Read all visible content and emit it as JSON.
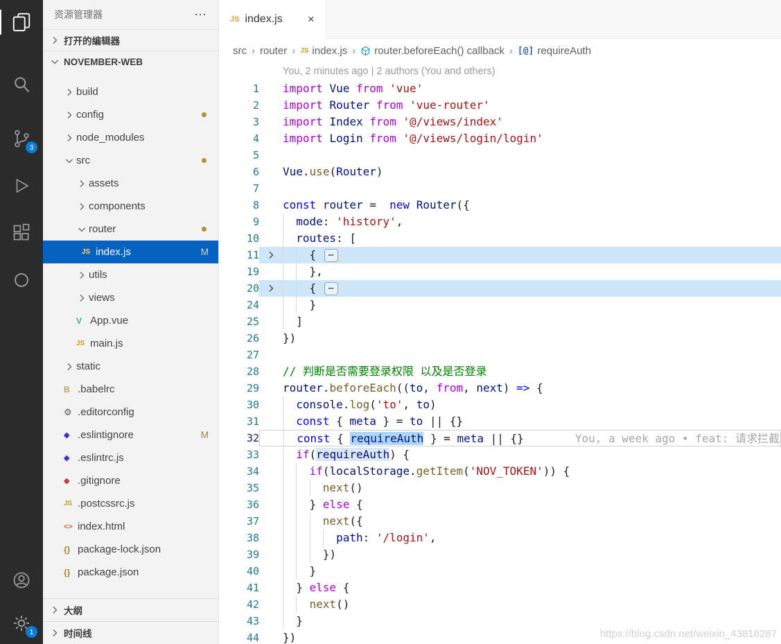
{
  "app": {
    "watermark": "https://blog.csdn.net/weixin_43816287"
  },
  "colors": {
    "activity_bar_bg": "#2b2b2b",
    "badge_blue": "#0c7bd5",
    "sidebar_bg": "#f3f3f3",
    "list_selection_bg": "#0661c1",
    "git_modified": "#a0852f",
    "fold_highlight_bg": "#cfe5f8",
    "selection_bg": "#add6ff",
    "syntax": {
      "keyword": "#af00db",
      "storage": "#0000ff",
      "string": "#a31515",
      "variable": "#001080",
      "function": "#795e26",
      "comment": "#008000",
      "plain": "#1e1e1e"
    }
  },
  "activity_bar": {
    "top": [
      {
        "icon": "explorer",
        "name": "explorer",
        "active": true
      },
      {
        "icon": "search",
        "name": "search"
      },
      {
        "icon": "source-control",
        "name": "source-control",
        "badge": "3"
      },
      {
        "icon": "run-debug",
        "name": "run-debug"
      },
      {
        "icon": "extensions",
        "name": "extensions"
      },
      {
        "icon": "circle",
        "name": "circle"
      }
    ],
    "bottom": [
      {
        "icon": "account",
        "name": "account"
      },
      {
        "icon": "settings",
        "name": "settings",
        "badge": "1"
      }
    ]
  },
  "sidebar": {
    "title": "资源管理器",
    "more_label": "⋯",
    "open_editors_label": "打开的编辑器",
    "root_label": "NOVEMBER-WEB",
    "outline_label": "大纲",
    "timeline_label": "时间线",
    "tree": [
      {
        "label": "build",
        "kind": "folder",
        "level": 1,
        "state": "collapsed"
      },
      {
        "label": "config",
        "kind": "folder",
        "level": 1,
        "state": "collapsed",
        "dot": true
      },
      {
        "label": "node_modules",
        "kind": "folder",
        "level": 1,
        "state": "collapsed"
      },
      {
        "label": "src",
        "kind": "folder",
        "level": 1,
        "state": "expanded",
        "dot": true
      },
      {
        "label": "assets",
        "kind": "folder",
        "level": 2,
        "state": "collapsed"
      },
      {
        "label": "components",
        "kind": "folder",
        "level": 2,
        "state": "collapsed"
      },
      {
        "label": "router",
        "kind": "folder",
        "level": 2,
        "state": "expanded",
        "dot": true
      },
      {
        "label": "index.js",
        "kind": "file",
        "icon": "js",
        "level": 3,
        "selected": true,
        "badge": "M"
      },
      {
        "label": "utils",
        "kind": "folder",
        "level": 2,
        "state": "collapsed"
      },
      {
        "label": "views",
        "kind": "folder",
        "level": 2,
        "state": "collapsed"
      },
      {
        "label": "App.vue",
        "kind": "file",
        "icon": "vue",
        "level": 2
      },
      {
        "label": "main.js",
        "kind": "file",
        "icon": "js",
        "level": 2
      },
      {
        "label": "static",
        "kind": "folder",
        "level": 1,
        "state": "collapsed"
      },
      {
        "label": ".babelrc",
        "kind": "file",
        "icon": "babel",
        "level": 1
      },
      {
        "label": ".editorconfig",
        "kind": "file",
        "icon": "editorconfig",
        "level": 1
      },
      {
        "label": ".eslintignore",
        "kind": "file",
        "icon": "eslint",
        "level": 1,
        "badge": "M"
      },
      {
        "label": ".eslintrc.js",
        "kind": "file",
        "icon": "eslint",
        "level": 1
      },
      {
        "label": ".gitignore",
        "kind": "file",
        "icon": "git",
        "level": 1
      },
      {
        "label": ".postcssrc.js",
        "kind": "file",
        "icon": "js",
        "level": 1
      },
      {
        "label": "index.html",
        "kind": "file",
        "icon": "html",
        "level": 1
      },
      {
        "label": "package-lock.json",
        "kind": "file",
        "icon": "json",
        "level": 1
      },
      {
        "label": "package.json",
        "kind": "file",
        "icon": "json",
        "level": 1
      }
    ]
  },
  "editor": {
    "tab": {
      "label": "index.js",
      "icon": "js",
      "close": "×"
    },
    "breadcrumbs": [
      {
        "label": "src"
      },
      {
        "label": "router"
      },
      {
        "label": "index.js",
        "icon": "js"
      },
      {
        "label": "router.beforeEach() callback",
        "icon": "symbol-method"
      },
      {
        "label": "requireAuth",
        "icon": "symbol-field"
      }
    ],
    "codelens": "You, 2 minutes ago | 2 authors (You and others)",
    "inline_blame": "You, a week ago • feat: 请求拦截",
    "fold_placeholder": "⋯",
    "code_lines": [
      {
        "n": 1,
        "t": [
          [
            "import",
            "k"
          ],
          [
            " ",
            "p"
          ],
          [
            "Vue",
            "v"
          ],
          [
            " ",
            "p"
          ],
          [
            "from",
            "k"
          ],
          [
            " ",
            "p"
          ],
          [
            "'vue'",
            "t"
          ]
        ]
      },
      {
        "n": 2,
        "t": [
          [
            "import",
            "k"
          ],
          [
            " ",
            "p"
          ],
          [
            "Router",
            "v"
          ],
          [
            " ",
            "p"
          ],
          [
            "from",
            "k"
          ],
          [
            " ",
            "p"
          ],
          [
            "'vue-router'",
            "t"
          ]
        ]
      },
      {
        "n": 3,
        "t": [
          [
            "import",
            "k"
          ],
          [
            " ",
            "p"
          ],
          [
            "Index",
            "v"
          ],
          [
            " ",
            "p"
          ],
          [
            "from",
            "k"
          ],
          [
            " ",
            "p"
          ],
          [
            "'@/views/index'",
            "t"
          ]
        ]
      },
      {
        "n": 4,
        "t": [
          [
            "import",
            "k"
          ],
          [
            " ",
            "p"
          ],
          [
            "Login",
            "v"
          ],
          [
            " ",
            "p"
          ],
          [
            "from",
            "k"
          ],
          [
            " ",
            "p"
          ],
          [
            "'@/views/login/login'",
            "t"
          ]
        ]
      },
      {
        "n": 5,
        "t": []
      },
      {
        "n": 6,
        "t": [
          [
            "Vue",
            "v"
          ],
          [
            ".",
            "p"
          ],
          [
            "use",
            "f"
          ],
          [
            "(",
            "p"
          ],
          [
            "Router",
            "v"
          ],
          [
            ")",
            "p"
          ]
        ]
      },
      {
        "n": 7,
        "t": []
      },
      {
        "n": 8,
        "t": [
          [
            "const",
            "s"
          ],
          [
            " ",
            "p"
          ],
          [
            "router",
            "v"
          ],
          [
            " =  ",
            "p"
          ],
          [
            "new",
            "s"
          ],
          [
            " ",
            "p"
          ],
          [
            "Router",
            "v"
          ],
          [
            "({",
            "p"
          ]
        ]
      },
      {
        "n": 9,
        "t": [
          [
            "  ",
            "p"
          ],
          [
            "mode",
            "v"
          ],
          [
            ": ",
            "p"
          ],
          [
            "'history'",
            "t"
          ],
          [
            ",",
            "p"
          ]
        ]
      },
      {
        "n": 10,
        "t": [
          [
            "  ",
            "p"
          ],
          [
            "routes",
            "v"
          ],
          [
            ": [",
            "p"
          ]
        ]
      },
      {
        "n": 11,
        "fold": true,
        "hl": true,
        "t": [
          [
            "    { ",
            "p"
          ]
        ]
      },
      {
        "n": 19,
        "t": [
          [
            "    },",
            "p"
          ]
        ]
      },
      {
        "n": 20,
        "fold": true,
        "hl": true,
        "t": [
          [
            "    { ",
            "p"
          ]
        ]
      },
      {
        "n": 24,
        "t": [
          [
            "    }",
            "p"
          ]
        ]
      },
      {
        "n": 25,
        "t": [
          [
            "  ]",
            "p"
          ]
        ]
      },
      {
        "n": 26,
        "t": [
          [
            "})",
            "p"
          ]
        ]
      },
      {
        "n": 27,
        "t": []
      },
      {
        "n": 28,
        "t": [
          [
            "// 判断是否需要登录权限 以及是否登录",
            "c"
          ]
        ]
      },
      {
        "n": 29,
        "t": [
          [
            "router",
            "v"
          ],
          [
            ".",
            "p"
          ],
          [
            "beforeEach",
            "f"
          ],
          [
            "((",
            "p"
          ],
          [
            "to",
            "v"
          ],
          [
            ", ",
            "p"
          ],
          [
            "from",
            "k"
          ],
          [
            ", ",
            "p"
          ],
          [
            "next",
            "v"
          ],
          [
            ") ",
            "p"
          ],
          [
            "=>",
            "s"
          ],
          [
            " {",
            "p"
          ]
        ]
      },
      {
        "n": 30,
        "t": [
          [
            "  ",
            "p"
          ],
          [
            "console",
            "v"
          ],
          [
            ".",
            "p"
          ],
          [
            "log",
            "f"
          ],
          [
            "(",
            "p"
          ],
          [
            "'to'",
            "t"
          ],
          [
            ", ",
            "p"
          ],
          [
            "to",
            "v"
          ],
          [
            ")",
            "p"
          ]
        ]
      },
      {
        "n": 31,
        "t": [
          [
            "  ",
            "p"
          ],
          [
            "const",
            "s"
          ],
          [
            " { ",
            "p"
          ],
          [
            "meta",
            "v"
          ],
          [
            " } = ",
            "p"
          ],
          [
            "to",
            "v"
          ],
          [
            " || {}",
            "p"
          ]
        ]
      },
      {
        "n": 32,
        "cur": true,
        "blame": true,
        "t": [
          [
            "  ",
            "p"
          ],
          [
            "const",
            "s"
          ],
          [
            " { ",
            "p"
          ],
          [
            "requireAuth",
            "v sel"
          ],
          [
            " } = ",
            "p"
          ],
          [
            "meta",
            "v"
          ],
          [
            " || {}",
            "p"
          ]
        ]
      },
      {
        "n": 33,
        "t": [
          [
            "  ",
            "p"
          ],
          [
            "if",
            "k"
          ],
          [
            "(",
            "p"
          ],
          [
            "requireAuth",
            "v occ"
          ],
          [
            ") {",
            "p"
          ]
        ]
      },
      {
        "n": 34,
        "t": [
          [
            "    ",
            "p"
          ],
          [
            "if",
            "k"
          ],
          [
            "(",
            "p"
          ],
          [
            "localStorage",
            "v"
          ],
          [
            ".",
            "p"
          ],
          [
            "getItem",
            "f"
          ],
          [
            "(",
            "p"
          ],
          [
            "'NOV_TOKEN'",
            "t"
          ],
          [
            ")) {",
            "p"
          ]
        ]
      },
      {
        "n": 35,
        "t": [
          [
            "      ",
            "p"
          ],
          [
            "next",
            "f"
          ],
          [
            "()",
            "p"
          ]
        ]
      },
      {
        "n": 36,
        "t": [
          [
            "    } ",
            "p"
          ],
          [
            "else",
            "k"
          ],
          [
            " {",
            "p"
          ]
        ]
      },
      {
        "n": 37,
        "t": [
          [
            "      ",
            "p"
          ],
          [
            "next",
            "f"
          ],
          [
            "({",
            "p"
          ]
        ]
      },
      {
        "n": 38,
        "t": [
          [
            "        ",
            "p"
          ],
          [
            "path",
            "v"
          ],
          [
            ": ",
            "p"
          ],
          [
            "'/login'",
            "t"
          ],
          [
            ",",
            "p"
          ]
        ]
      },
      {
        "n": 39,
        "t": [
          [
            "      })",
            "p"
          ]
        ]
      },
      {
        "n": 40,
        "t": [
          [
            "    }",
            "p"
          ]
        ]
      },
      {
        "n": 41,
        "t": [
          [
            "  } ",
            "p"
          ],
          [
            "else",
            "k"
          ],
          [
            " {",
            "p"
          ]
        ]
      },
      {
        "n": 42,
        "t": [
          [
            "    ",
            "p"
          ],
          [
            "next",
            "f"
          ],
          [
            "()",
            "p"
          ]
        ]
      },
      {
        "n": 43,
        "t": [
          [
            "  }",
            "p"
          ]
        ]
      },
      {
        "n": 44,
        "t": [
          [
            "})",
            "p"
          ]
        ]
      }
    ]
  }
}
